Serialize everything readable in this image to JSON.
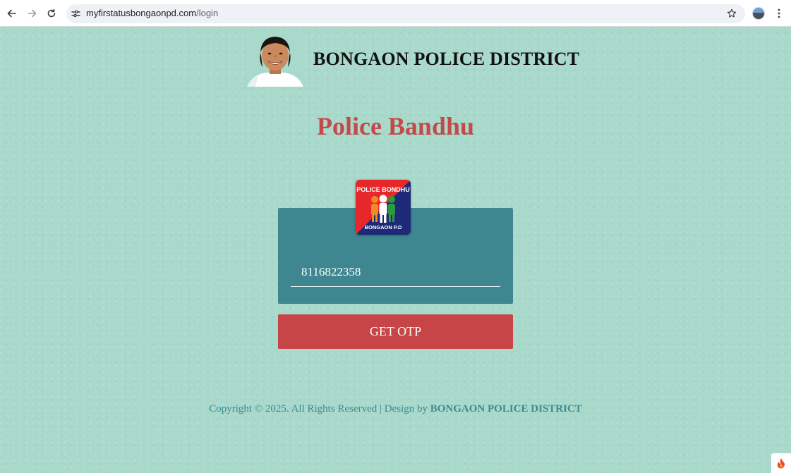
{
  "browser": {
    "url_host": "myfirstatusbongaonpd.com",
    "url_path": "/login",
    "icons": [
      "back-arrow-icon",
      "forward-arrow-icon",
      "reload-icon",
      "site-settings-icon",
      "bookmark-star-icon",
      "profile-avatar-icon",
      "more-menu-icon"
    ]
  },
  "header": {
    "site_title": "BONGAON POLICE DISTRICT"
  },
  "main": {
    "app_title": "Police Bandhu",
    "logo": {
      "top_text": "POLICE BONDHU",
      "bottom_text": "BONGAON P.D"
    },
    "phone_value": "8116822358",
    "button_label": "GET OTP"
  },
  "footer": {
    "copyright": "Copyright © 2025. All Rights Reserved | Design by ",
    "designer": "BONGAON POLICE DISTRICT"
  },
  "colors": {
    "background": "#a8d9cb",
    "card": "#3e8790",
    "accent_red": "#c74546",
    "title_red": "#c34a48",
    "footer_text": "#3d8a91"
  }
}
